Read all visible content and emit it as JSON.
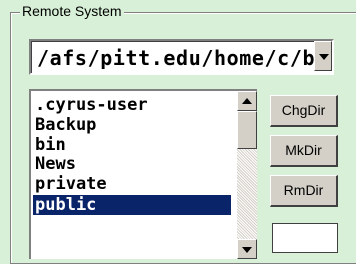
{
  "remote_system": {
    "group_title": "Remote System",
    "path": "/afs/pitt.edu/home/c/b/",
    "files": [
      ".cyrus-user",
      "Backup",
      "bin",
      "News",
      "private",
      "public"
    ],
    "selected_file": "public",
    "buttons": {
      "chgdir": "ChgDir",
      "mkdir": "MkDir",
      "rmdir": "RmDir"
    }
  },
  "colors": {
    "background": "#d7f0d7",
    "selection": "#0a246a",
    "button_face": "#d4d0c8"
  },
  "icons": [
    "chevron-down-icon",
    "scroll-up-arrow-icon",
    "scroll-down-arrow-icon"
  ]
}
